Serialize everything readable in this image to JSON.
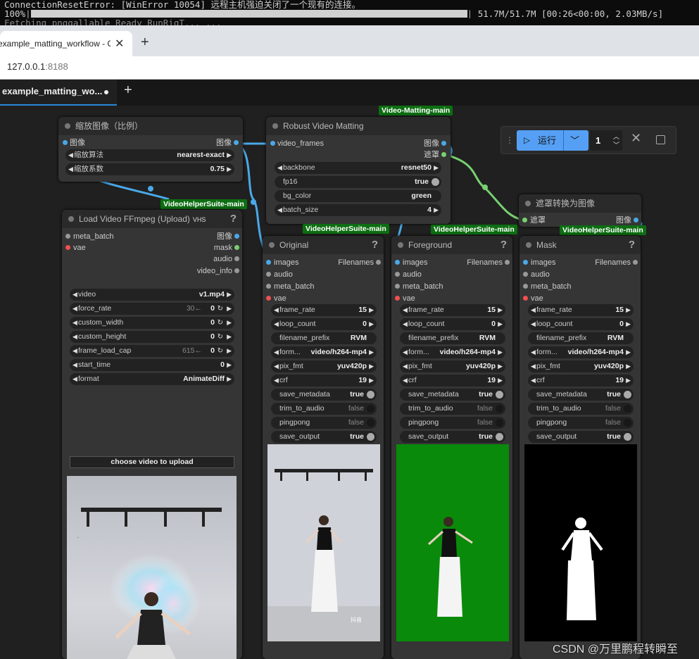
{
  "terminal": {
    "line1": "ConnectionResetError: [WinError 10054] 远程主机强迫关闭了一个现有的连接。",
    "progress_pct": "100%",
    "progress_tail": " 51.7M/51.7M [00:26<00:00, 2.03MB/s]",
    "line3": "Fetching pnggallable Ready RunRigT... ..."
  },
  "browser": {
    "tab_title": "example_matting_workflow - Co",
    "new_tab": "+",
    "close": "✕",
    "url_host": "127.0.0.1",
    "url_port": ":8188"
  },
  "app": {
    "workflow_tab": "example_matting_wo...",
    "add_tab": "+",
    "run": {
      "label": "运行",
      "count": "1"
    }
  },
  "groups": {
    "vm_main": "Video-Matting-main",
    "vhs_main_1": "VideoHelperSuite-main",
    "vhs_main_2": "VideoHelperSuite-main",
    "vhs_main_3": "VideoHelperSuite-main",
    "vhs_main_4": "VideoHelperSuite-main"
  },
  "scale_node": {
    "title": "缩放图像（比例）",
    "in": "图像",
    "out": "图像",
    "w1_label": "缩放算法",
    "w1_val": "nearest-exact",
    "w2_label": "缩放系数",
    "w2_val": "0.75"
  },
  "rvm_node": {
    "title": "Robust Video Matting",
    "in": "video_frames",
    "out1": "图像",
    "out2": "遮罩",
    "w_backbone": "backbone",
    "w_backbone_v": "resnet50",
    "w_fp16": "fp16",
    "w_fp16_v": "true",
    "w_bg": "bg_color",
    "w_bg_v": "green",
    "w_bs": "batch_size",
    "w_bs_v": "4"
  },
  "mask_conv": {
    "title": "遮罩转换为图像",
    "in": "遮罩",
    "out": "图像"
  },
  "load_node": {
    "title": "Load Video FFmpeg (Upload)",
    "badge": "VHS",
    "in1": "meta_batch",
    "in2": "vae",
    "out1": "图像",
    "out2": "mask",
    "out3": "audio",
    "out4": "video_info",
    "widgets": [
      {
        "l": "video",
        "v": "v1.mp4",
        "extra": ""
      },
      {
        "l": "force_rate",
        "v": "0",
        "extra": "30←"
      },
      {
        "l": "custom_width",
        "v": "0",
        "extra": ""
      },
      {
        "l": "custom_height",
        "v": "0",
        "extra": ""
      },
      {
        "l": "frame_load_cap",
        "v": "0",
        "extra": "615←"
      },
      {
        "l": "start_time",
        "v": "0",
        "extra": ""
      },
      {
        "l": "format",
        "v": "AnimateDiff",
        "extra": ""
      }
    ],
    "upload": "choose video to upload"
  },
  "combine_common": {
    "in1": "images",
    "in2": "audio",
    "in3": "meta_batch",
    "in4": "vae",
    "out": "Filenames",
    "widgets": [
      {
        "l": "frame_rate",
        "v": "15"
      },
      {
        "l": "loop_count",
        "v": "0"
      },
      {
        "l": "filename_prefix",
        "v": "RVM"
      },
      {
        "l": "form...",
        "v": "video/h264-mp4"
      },
      {
        "l": "pix_fmt",
        "v": "yuv420p"
      },
      {
        "l": "crf",
        "v": "19"
      },
      {
        "l": "save_metadata",
        "v": "true"
      },
      {
        "l": "trim_to_audio",
        "v": "false"
      },
      {
        "l": "pingpong",
        "v": "false"
      },
      {
        "l": "save_output",
        "v": "true"
      }
    ]
  },
  "combine_titles": [
    "Original",
    "Foreground",
    "Mask"
  ],
  "watermark": "CSDN @万里鹏程转瞬至",
  "douyin": "抖音"
}
